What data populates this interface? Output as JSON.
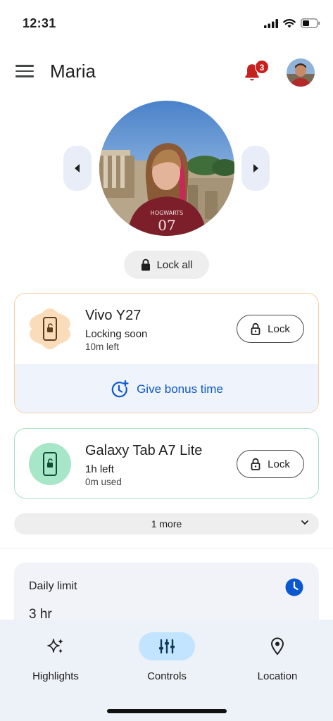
{
  "status_bar": {
    "time": "12:31"
  },
  "header": {
    "child_name": "Maria",
    "notification_count": "3"
  },
  "profile": {
    "lock_all_label": "Lock all"
  },
  "devices": [
    {
      "name": "Vivo Y27",
      "status": "Locking soon",
      "sub": "10m left",
      "lock_label": "Lock",
      "bonus_label": "Give bonus time",
      "accent": "#fbdcba"
    },
    {
      "name": "Galaxy Tab A7 Lite",
      "status": "1h left",
      "sub": "0m used",
      "lock_label": "Lock",
      "accent": "#a8e6c8"
    }
  ],
  "more": {
    "label": "1 more"
  },
  "daily_limit": {
    "title": "Daily limit",
    "value": "3 hr"
  },
  "bottom_nav": [
    {
      "label": "Highlights",
      "icon": "sparkle-icon"
    },
    {
      "label": "Controls",
      "icon": "sliders-icon",
      "active": true
    },
    {
      "label": "Location",
      "icon": "location-pin-icon"
    }
  ],
  "colors": {
    "accent_blue": "#0b57d0",
    "badge_red": "#c5221f",
    "active_nav": "#c2e4ff"
  }
}
